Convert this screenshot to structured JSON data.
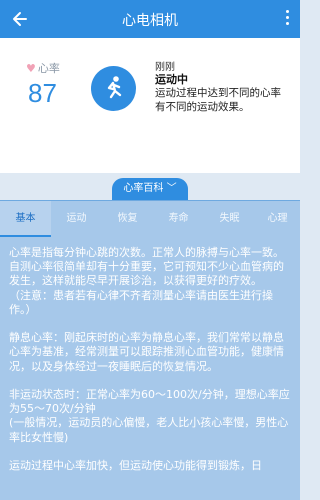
{
  "appbar": {
    "title": "心电相机"
  },
  "summary": {
    "hr_label": "心率",
    "hr_value": "87",
    "status_name": "刚刚",
    "status_title": "运动中",
    "status_desc": "运动过程中达到不同的心率有不同的运动效果。"
  },
  "encyclopedia": {
    "label": "心率百科"
  },
  "tabs": [
    "基本",
    "运动",
    "恢复",
    "寿命",
    "失眠",
    "心理"
  ],
  "content": {
    "text": "心率是指每分钟心跳的次数。正常人的脉搏与心率一致。自测心率很简单却有十分重要，它可预知不少心血管病的发生，这样就能尽早开展诊治，以获得更好的疗效。\n（注意：患者若有心律不齐者测量心率请由医生进行操作。）\n\n静息心率：刚起床时的心率为静息心率，我们常常以静息心率为基准，经常测量可以跟踪推测心血管功能，健康情况，以及身体经过一夜睡眠后的恢复情况。\n\n非运动状态时：正常心率为60～100次/分钟，理想心率应为55～70次/分钟\n(一般情况，运动员的心偏慢，老人比小孩心率慢，男性心率比女性慢)\n\n运动过程中心率加快，但运动使心功能得到锻炼，日"
  },
  "colors": {
    "primary": "#2f8de0",
    "panel": "#a6c8ea",
    "heart": "#f1a2b6"
  },
  "icons": {
    "back": "arrow-left-icon",
    "more": "more-vert-icon",
    "heart": "heart-icon",
    "run": "running-person-icon",
    "chevron": "chevron-down-icon"
  }
}
